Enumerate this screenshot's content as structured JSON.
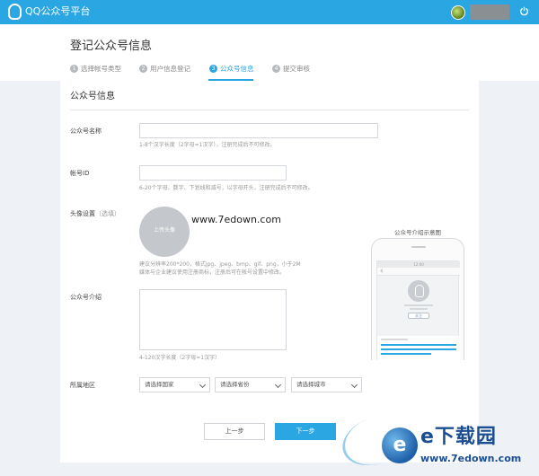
{
  "topbar": {
    "app_title": "QQ公众号平台",
    "accent_color": "#2aa6e2"
  },
  "page": {
    "title": "登记公众号信息",
    "steps": [
      {
        "num": "1",
        "label": "选择帐号类型",
        "state": "done"
      },
      {
        "num": "2",
        "label": "用户信息登记",
        "state": "done"
      },
      {
        "num": "3",
        "label": "公众号信息",
        "state": "active"
      },
      {
        "num": "4",
        "label": "提交审核",
        "state": "pending"
      }
    ]
  },
  "form": {
    "section_title": "公众号信息",
    "name": {
      "label": "公众号名称",
      "value": "",
      "hint": "1-8个汉字长度（2字母=1汉字），注册完成后不可修改。"
    },
    "account_id": {
      "label": "帐号ID",
      "value": "",
      "hint": "6-20个字母、数字、下划线和减号，以字母开头，注册完成后不可修改。"
    },
    "avatar": {
      "label": "头像设置",
      "optional": "（选填）",
      "upload_label": "上传头像",
      "hint_line1": "建议分辨率200*200，格式jpg、jpeg、bmp、gif、png，小于2M",
      "hint_line2": "媒体与企业建议使用注册商标，注册后可在帐号设置中修改。"
    },
    "intro": {
      "label": "公众号介绍",
      "value": "",
      "hint": "4-120汉字长度（2字母=1汉字）"
    },
    "region": {
      "label": "所属地区",
      "country": "请选择国家",
      "province": "请选择省份",
      "city": "请选择城市"
    },
    "buttons": {
      "prev": "上一步",
      "next": "下一步"
    }
  },
  "preview": {
    "title": "公众号介绍示意图",
    "time": "12:00",
    "follow": "关注"
  },
  "watermarks": {
    "center": "www.7edown.com",
    "brand": "e下载园",
    "brand_letter": "e",
    "brand_url": "www.7edown.com"
  }
}
